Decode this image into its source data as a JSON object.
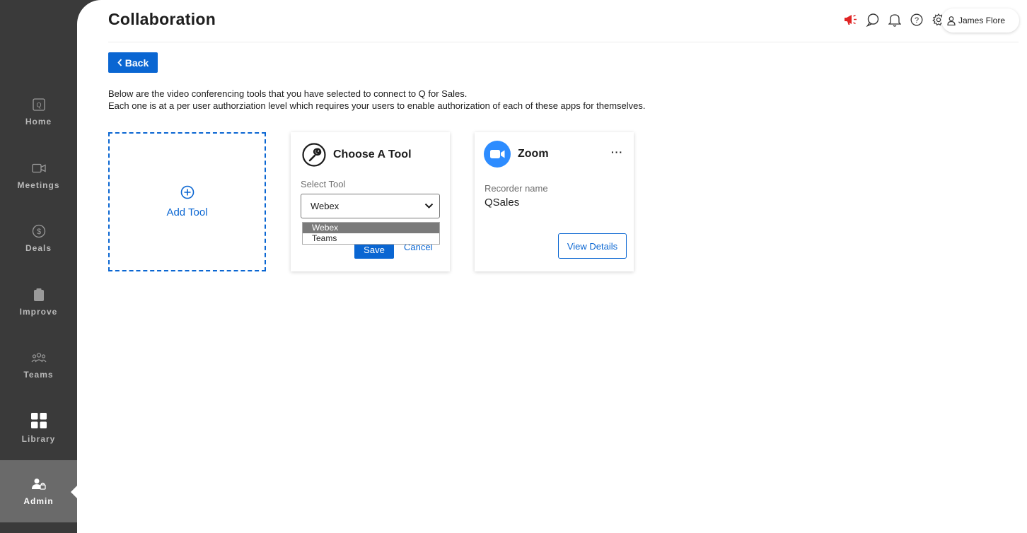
{
  "colors": {
    "accent": "#0a66d2",
    "sidebar_bg": "#3a3a3a",
    "sidebar_active": "#6a6a6a",
    "announce_red": "#e02424",
    "zoom_blue": "#2d8cff"
  },
  "sidebar": {
    "items": [
      {
        "label": "Home",
        "icon": "home-icon"
      },
      {
        "label": "Meetings",
        "icon": "video-camera-icon"
      },
      {
        "label": "Deals",
        "icon": "dollar-icon"
      },
      {
        "label": "Improve",
        "icon": "clipboard-icon"
      },
      {
        "label": "Teams",
        "icon": "team-icon"
      },
      {
        "label": "Library",
        "icon": "grid-icon"
      },
      {
        "label": "Admin",
        "icon": "admin-icon",
        "active": true
      }
    ]
  },
  "header": {
    "title": "Collaboration",
    "user_name": "James Flore",
    "icons": [
      "megaphone-icon",
      "chat-icon",
      "bell-icon",
      "help-icon",
      "gear-icon"
    ]
  },
  "back_button": {
    "label": "Back"
  },
  "description": {
    "line1": "Below are the video conferencing tools that you have selected to connect to Q for Sales.",
    "line2": "Each one is at a per user authorziation level which requires your users to enable authorization of each of these apps for themselves."
  },
  "add_card": {
    "label": "Add Tool"
  },
  "choose_card": {
    "title": "Choose A Tool",
    "select_label": "Select Tool",
    "selected_value": "Webex",
    "options": [
      "Webex",
      "Teams"
    ],
    "save_label": "Save",
    "cancel_label": "Cancel"
  },
  "zoom_card": {
    "title": "Zoom",
    "menu": "···",
    "recorder_label": "Recorder name",
    "recorder_value": "QSales",
    "details_label": "View Details"
  }
}
